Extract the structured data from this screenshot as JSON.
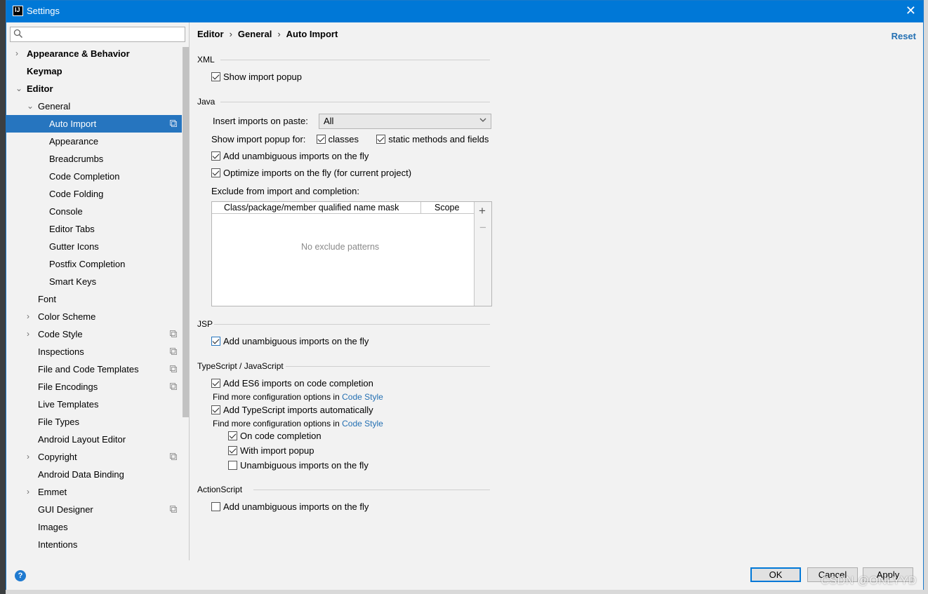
{
  "window": {
    "title": "Settings",
    "app_icon": "IJ",
    "close": "✕"
  },
  "search": {
    "placeholder": ""
  },
  "sidebar": {
    "items": [
      {
        "label": "Appearance & Behavior",
        "level": 0,
        "bold": true,
        "arrow": "›"
      },
      {
        "label": "Keymap",
        "level": 0,
        "bold": true,
        "arrow": ""
      },
      {
        "label": "Editor",
        "level": 0,
        "bold": true,
        "arrow": "⌄"
      },
      {
        "label": "General",
        "level": 1,
        "arrow": "⌄"
      },
      {
        "label": "Auto Import",
        "level": 2,
        "selected": true,
        "copy": true
      },
      {
        "label": "Appearance",
        "level": 2
      },
      {
        "label": "Breadcrumbs",
        "level": 2
      },
      {
        "label": "Code Completion",
        "level": 2
      },
      {
        "label": "Code Folding",
        "level": 2
      },
      {
        "label": "Console",
        "level": 2
      },
      {
        "label": "Editor Tabs",
        "level": 2
      },
      {
        "label": "Gutter Icons",
        "level": 2
      },
      {
        "label": "Postfix Completion",
        "level": 2
      },
      {
        "label": "Smart Keys",
        "level": 2
      },
      {
        "label": "Font",
        "level": 1
      },
      {
        "label": "Color Scheme",
        "level": 1,
        "arrow": "›"
      },
      {
        "label": "Code Style",
        "level": 1,
        "arrow": "›",
        "copy": true
      },
      {
        "label": "Inspections",
        "level": 1,
        "copy": true
      },
      {
        "label": "File and Code Templates",
        "level": 1,
        "copy": true
      },
      {
        "label": "File Encodings",
        "level": 1,
        "copy": true
      },
      {
        "label": "Live Templates",
        "level": 1
      },
      {
        "label": "File Types",
        "level": 1
      },
      {
        "label": "Android Layout Editor",
        "level": 1
      },
      {
        "label": "Copyright",
        "level": 1,
        "arrow": "›",
        "copy": true
      },
      {
        "label": "Android Data Binding",
        "level": 1
      },
      {
        "label": "Emmet",
        "level": 1,
        "arrow": "›"
      },
      {
        "label": "GUI Designer",
        "level": 1,
        "copy": true
      },
      {
        "label": "Images",
        "level": 1
      },
      {
        "label": "Intentions",
        "level": 1
      }
    ]
  },
  "breadcrumb": {
    "a": "Editor",
    "b": "General",
    "c": "Auto Import",
    "sep": "›"
  },
  "reset_label": "Reset",
  "xml": {
    "heading": "XML",
    "show_import_popup": {
      "label": "Show import popup",
      "checked": true
    }
  },
  "java": {
    "heading": "Java",
    "insert_label": "Insert imports on paste:",
    "insert_value": "All",
    "show_popup_for": "Show import popup for:",
    "classes": {
      "label": "classes",
      "checked": true
    },
    "static_methods": {
      "label": "static methods and fields",
      "checked": true
    },
    "add_unambiguous": {
      "label": "Add unambiguous imports on the fly",
      "checked": true
    },
    "optimize": {
      "label": "Optimize imports on the fly (for current project)",
      "checked": true
    },
    "exclude_label": "Exclude from import and completion:",
    "table": {
      "col1": "Class/package/member qualified name mask",
      "col2": "Scope",
      "empty": "No exclude patterns",
      "add": "+",
      "remove": "−"
    }
  },
  "jsp": {
    "heading": "JSP",
    "add_unambiguous": {
      "label": "Add unambiguous imports on the fly",
      "checked": true
    }
  },
  "ts": {
    "heading": "TypeScript / JavaScript",
    "es6": {
      "label": "Add ES6 imports on code completion",
      "checked": true
    },
    "find_more_1": "Find more configuration options in",
    "code_style_link": "Code Style",
    "ts_auto": {
      "label": "Add TypeScript imports automatically",
      "checked": true
    },
    "find_more_2": "Find more configuration options in",
    "on_completion": {
      "label": "On code completion",
      "checked": true
    },
    "with_popup": {
      "label": "With import popup",
      "checked": true
    },
    "unambiguous": {
      "label": "Unambiguous imports on the fly",
      "checked": false
    }
  },
  "actionscript": {
    "heading": "ActionScript",
    "add_unambiguous": {
      "label": "Add unambiguous imports on the fly",
      "checked": false
    }
  },
  "buttons": {
    "ok": "OK",
    "cancel": "Cancel",
    "apply": "Apply",
    "help": "?"
  },
  "watermark": "CSDN @ONLYYD",
  "colors": {
    "accent": "#0078d7",
    "selection": "#2675bf",
    "link": "#2470b3"
  }
}
